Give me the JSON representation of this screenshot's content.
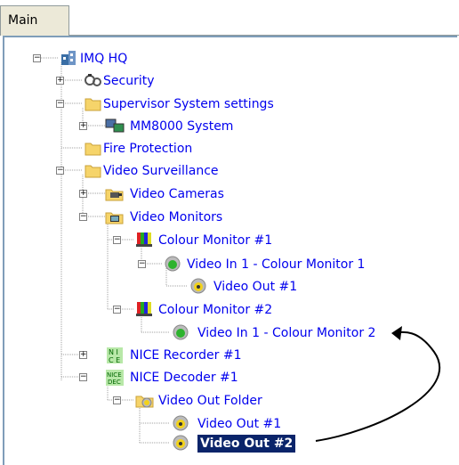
{
  "tab": {
    "label": "Main"
  },
  "tree": [
    {
      "id": "imq-hq",
      "label": "IMQ HQ",
      "icon": "building-icon",
      "expander": "minus"
    },
    {
      "id": "security",
      "label": "Security",
      "icon": "security-handcuffs-icon",
      "expander": "plus"
    },
    {
      "id": "supervisor",
      "label": "Supervisor System settings",
      "icon": "folder-icon",
      "expander": "minus"
    },
    {
      "id": "mm8000",
      "label": "MM8000 System",
      "icon": "computer-icon",
      "expander": "plus"
    },
    {
      "id": "fire",
      "label": "Fire Protection",
      "icon": "folder-icon",
      "expander": "none"
    },
    {
      "id": "video-surv",
      "label": "Video Surveillance",
      "icon": "folder-icon",
      "expander": "minus"
    },
    {
      "id": "video-cams",
      "label": "Video Cameras",
      "icon": "camera-icon",
      "expander": "plus"
    },
    {
      "id": "video-mons",
      "label": "Video Monitors",
      "icon": "monitor-folder-icon",
      "expander": "minus"
    },
    {
      "id": "colour-mon-1",
      "label": "Colour Monitor #1",
      "icon": "color-bars-icon",
      "expander": "minus"
    },
    {
      "id": "video-in-1-cm1",
      "label": "Video In 1 - Colour Monitor 1",
      "icon": "green-led-icon",
      "expander": "minus"
    },
    {
      "id": "video-out-1-a",
      "label": "Video Out #1",
      "icon": "yellow-led-icon",
      "expander": "none"
    },
    {
      "id": "colour-mon-2",
      "label": "Colour Monitor #2",
      "icon": "color-bars-icon",
      "expander": "minus"
    },
    {
      "id": "video-in-1-cm2",
      "label": "Video In 1 - Colour Monitor 2",
      "icon": "green-led-icon",
      "expander": "none"
    },
    {
      "id": "nice-rec",
      "label": "NICE Recorder #1",
      "icon": "nice-ce-icon",
      "expander": "plus"
    },
    {
      "id": "nice-dec",
      "label": "NICE Decoder #1",
      "icon": "nice-dec-icon",
      "expander": "minus"
    },
    {
      "id": "video-out-folder",
      "label": "Video Out Folder",
      "icon": "folder-yellow-led-icon",
      "expander": "minus"
    },
    {
      "id": "video-out-1-b",
      "label": "Video Out #1",
      "icon": "yellow-led-icon",
      "expander": "none"
    },
    {
      "id": "video-out-2",
      "label": "Video Out #2",
      "icon": "yellow-led-icon",
      "expander": "none",
      "selected": true
    }
  ]
}
